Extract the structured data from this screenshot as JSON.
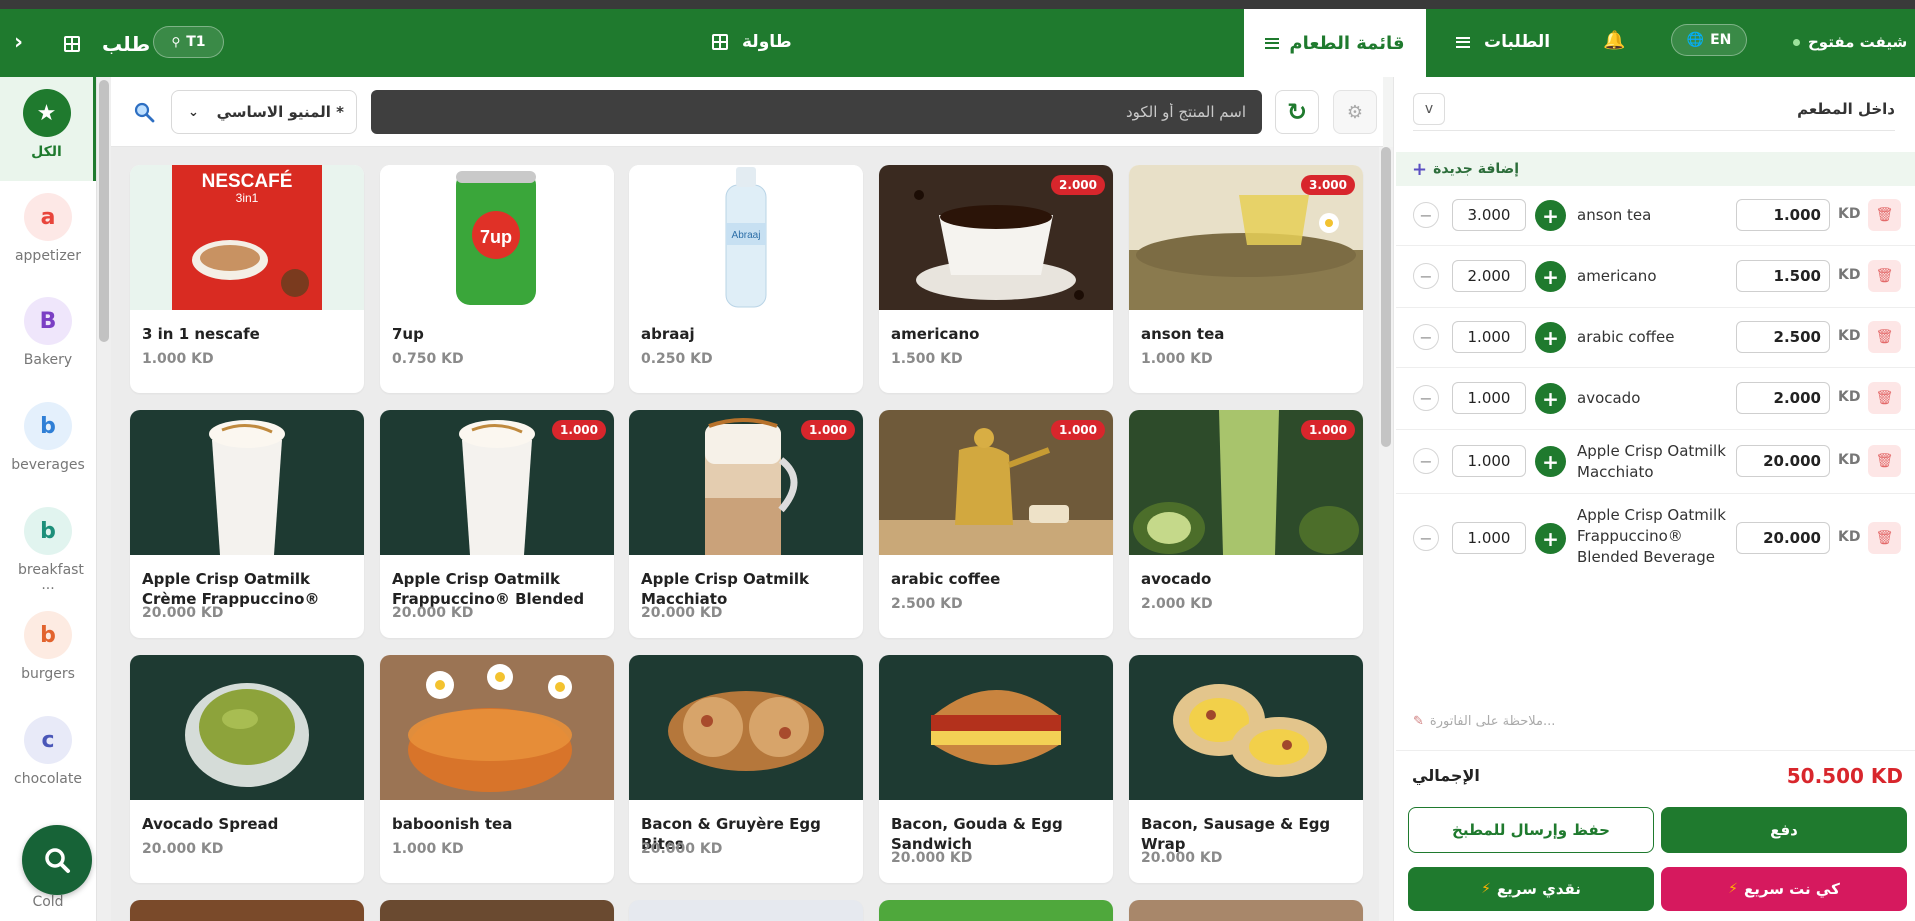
{
  "header": {
    "order_title": "طلب",
    "table_pill": "T1",
    "table_label": "طاولة",
    "menu_tab": "قائمة الطعام",
    "orders_tab": "الطلبات",
    "language": "EN",
    "shift_status": "شيفت مفتوح"
  },
  "sidebar": {
    "categories": [
      {
        "letter": "★",
        "label": "الكل",
        "color": "#1f7a2e"
      },
      {
        "letter": "a",
        "label": "appetizer",
        "color": "#e8453c"
      },
      {
        "letter": "B",
        "label": "Bakery",
        "color": "#7b3fc4"
      },
      {
        "letter": "b",
        "label": "beverages",
        "color": "#2f7fd6"
      },
      {
        "letter": "b",
        "label": "breakfast ...",
        "color": "#1d8f7a"
      },
      {
        "letter": "b",
        "label": "burgers",
        "color": "#e2632e"
      },
      {
        "letter": "c",
        "label": "chocolate",
        "color": "#4a57b8"
      },
      {
        "letter": "",
        "label": "Cold",
        "color": "#555555"
      }
    ]
  },
  "search": {
    "placeholder": "اسم المنتج أو الكود",
    "menu_select": "* المنيو الاساسي"
  },
  "products": [
    {
      "name": "3 in 1 nescafe",
      "price": "1.000 KD",
      "badge": ""
    },
    {
      "name": "7up",
      "price": "0.750 KD",
      "badge": ""
    },
    {
      "name": "abraaj",
      "price": "0.250 KD",
      "badge": ""
    },
    {
      "name": "americano",
      "price": "1.500 KD",
      "badge": "2.000"
    },
    {
      "name": "anson tea",
      "price": "1.000 KD",
      "badge": "3.000"
    },
    {
      "name": "Apple Crisp Oatmilk Crème Frappuccino® Blended",
      "price": "20.000 KD",
      "badge": ""
    },
    {
      "name": "Apple Crisp Oatmilk Frappuccino® Blended",
      "price": "20.000 KD",
      "badge": "1.000"
    },
    {
      "name": "Apple Crisp Oatmilk Macchiato",
      "price": "20.000 KD",
      "badge": "1.000"
    },
    {
      "name": "arabic coffee",
      "price": "2.500 KD",
      "badge": "1.000"
    },
    {
      "name": "avocado",
      "price": "2.000 KD",
      "badge": "1.000"
    },
    {
      "name": "Avocado Spread",
      "price": "20.000 KD",
      "badge": ""
    },
    {
      "name": "baboonish tea",
      "price": "1.000 KD",
      "badge": ""
    },
    {
      "name": "Bacon & Gruyère Egg Bites",
      "price": "20.000 KD",
      "badge": ""
    },
    {
      "name": "Bacon, Gouda & Egg Sandwich",
      "price": "20.000 KD",
      "badge": ""
    },
    {
      "name": "Bacon, Sausage & Egg Wrap",
      "price": "20.000 KD",
      "badge": ""
    }
  ],
  "order": {
    "service_type": "داخل المطعم",
    "add_new": "إضافة جديدة",
    "items": [
      {
        "qty": "3.000",
        "name": "anson tea",
        "price": "1.000",
        "currency": "KD"
      },
      {
        "qty": "2.000",
        "name": "americano",
        "price": "1.500",
        "currency": "KD"
      },
      {
        "qty": "1.000",
        "name": "arabic coffee",
        "price": "2.500",
        "currency": "KD"
      },
      {
        "qty": "1.000",
        "name": "avocado",
        "price": "2.000",
        "currency": "KD"
      },
      {
        "qty": "1.000",
        "name": "Apple Crisp Oatmilk Macchiato",
        "price": "20.000",
        "currency": "KD"
      },
      {
        "qty": "1.000",
        "name": "Apple Crisp Oatmilk Frappuccino® Blended Beverage",
        "price": "20.000",
        "currency": "KD"
      }
    ],
    "note_placeholder": "ملاحظة على الفاتورة...",
    "total_label": "الإجمالي",
    "total_value": "50.500 KD",
    "save_send_label": "حفظ وإرسال للمطبخ",
    "pay_label": "دفع",
    "quick_cash_label": "نقدي سريع",
    "quick_knet_label": "كي نت سريع"
  },
  "colors": {
    "brand_green": "#1f7a2e",
    "badge_red": "#d8262c",
    "knet_pink": "#d6195e"
  }
}
